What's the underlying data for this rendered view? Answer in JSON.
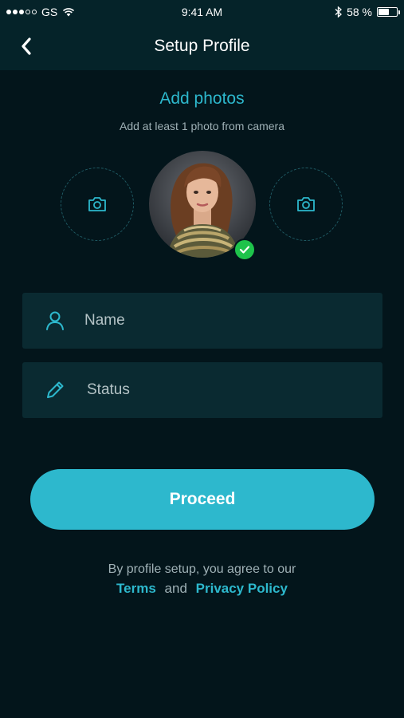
{
  "status_bar": {
    "carrier": "GS",
    "time": "9:41 AM",
    "battery_text": "58 %",
    "battery_level": 0.58
  },
  "nav": {
    "title": "Setup Profile",
    "back_icon": "chevron-left-icon"
  },
  "photos": {
    "title": "Add photos",
    "subtitle": "Add at least 1 photo from camera",
    "slot_icon": "camera-icon",
    "check_icon": "check-icon"
  },
  "form": {
    "name_placeholder": "Name",
    "status_placeholder": "Status",
    "name_icon": "user-icon",
    "status_icon": "pencil-icon"
  },
  "actions": {
    "proceed_label": "Proceed"
  },
  "terms": {
    "prefix": "By profile setup, you agree to our",
    "terms_link": "Terms",
    "connector": "and",
    "privacy_link": "Privacy Policy"
  },
  "colors": {
    "background": "#03151b",
    "header": "#052329",
    "accent": "#2db8cd",
    "field": "#0a2a31",
    "success": "#1ec34b"
  }
}
